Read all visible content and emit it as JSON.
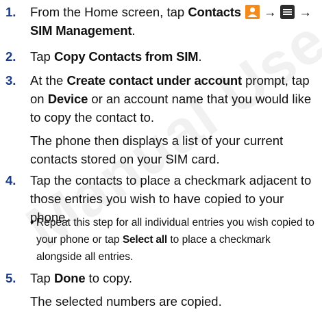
{
  "watermark": "Manual Use Only",
  "steps": [
    {
      "number": "1.",
      "part1": "From the Home screen, tap ",
      "contacts": "Contacts",
      "arrow": "→",
      "sim_management": "SIM Management",
      "end": "."
    },
    {
      "number": "2.",
      "pre": "Tap ",
      "kw": "Copy Contacts from SIM",
      "end": "."
    },
    {
      "number": "3.",
      "pre": "At the ",
      "kw1": "Create contact under account",
      "mid": " prompt, tap on ",
      "kw2": "Device",
      "post": " or an account name that you would like to copy the contact to.",
      "para": "The phone then displays a list of your current contacts stored on your SIM card."
    },
    {
      "number": "4.",
      "text": "Tap the contacts to place a checkmark adjacent to those entries you wish to have copied to your phone.",
      "bullet": "•",
      "bullet_pre": "Repeat this step for all individual entries you wish copied to your phone or tap ",
      "bullet_kw": "Select all",
      "bullet_post": " to place a checkmark alongside all entries."
    },
    {
      "number": "5.",
      "pre": "Tap ",
      "kw": "Done",
      "post": " to copy.",
      "para": "The selected numbers are copied."
    }
  ],
  "icons": {
    "contacts_color": "#f28a1e",
    "menu_color": "#2c2c2c"
  }
}
